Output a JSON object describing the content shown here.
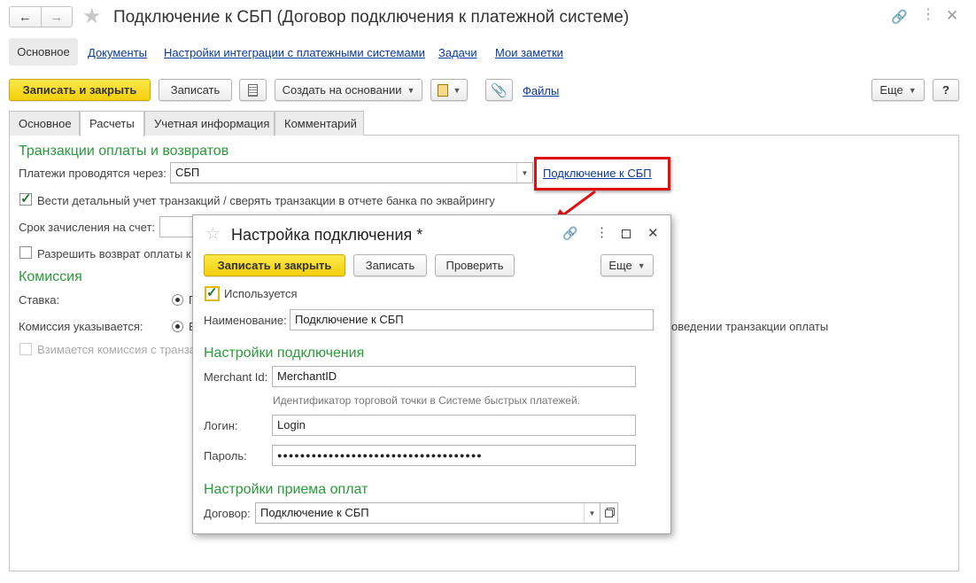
{
  "window": {
    "title": "Подключение к СБП (Договор подключения к платежной системе)"
  },
  "nav_tabs": [
    "Основное",
    "Документы",
    "Настройки интеграции с платежными системами",
    "Задачи",
    "Мои заметки"
  ],
  "toolbar": {
    "save_close": "Записать и закрыть",
    "save": "Записать",
    "create_based": "Создать на основании",
    "files": "Файлы",
    "more": "Еще",
    "help": "?"
  },
  "tabs": [
    "Основное",
    "Расчеты",
    "Учетная информация",
    "Комментарий"
  ],
  "form": {
    "section_transactions": "Транзакции оплаты и возвратов",
    "payments_via_label": "Платежи проводятся через:",
    "payments_via_value": "СБП",
    "connection_link": "Подключение к СБП",
    "detailed_accounting": "Вести детальный учет транзакций / сверять транзакции в отчете банка по эквайрингу",
    "credit_term_label": "Срок зачисления на счет:",
    "allow_refund": "Разрешить возврат оплаты к",
    "section_commission": "Комиссия",
    "rate_label": "Ставка:",
    "rate_option": "П",
    "commission_shown_label": "Комиссия указывается:",
    "commission_shown_option": "В",
    "commission_tail": "оведении транзакции оплаты",
    "commission_charged": "Взимается комиссия с транза"
  },
  "dialog": {
    "title": "Настройка подключения *",
    "save_close": "Записать и закрыть",
    "save": "Записать",
    "check": "Проверить",
    "more": "Еще",
    "used": "Используется",
    "name_label": "Наименование:",
    "name_value": "Подключение к СБП",
    "section_connection": "Настройки подключения",
    "merchant_label": "Merchant Id:",
    "merchant_value": "MerchantID",
    "merchant_hint": "Идентификатор торговой точки в Системе быстрых платежей.",
    "login_label": "Логин:",
    "login_value": "Login",
    "password_label": "Пароль:",
    "password_value": "●●●●●●●●●●●●●●●●●●●●●●●●●●●●●●●●●●●●",
    "section_payments": "Настройки приема оплат",
    "contract_label": "Договор:",
    "contract_value": "Подключение к СБП"
  },
  "icons": [
    "back-icon",
    "forward-icon",
    "star-icon",
    "link-icon",
    "kebab-icon",
    "close-icon",
    "report-icon",
    "copy-icon",
    "paperclip-icon",
    "maximize-icon",
    "dropdown-icon",
    "open-icon"
  ],
  "colors": {
    "accent_yellow": "#f5d313",
    "section_green": "#2b9a3b",
    "link_blue": "#0b3a9a",
    "highlight_red": "#e01010"
  }
}
